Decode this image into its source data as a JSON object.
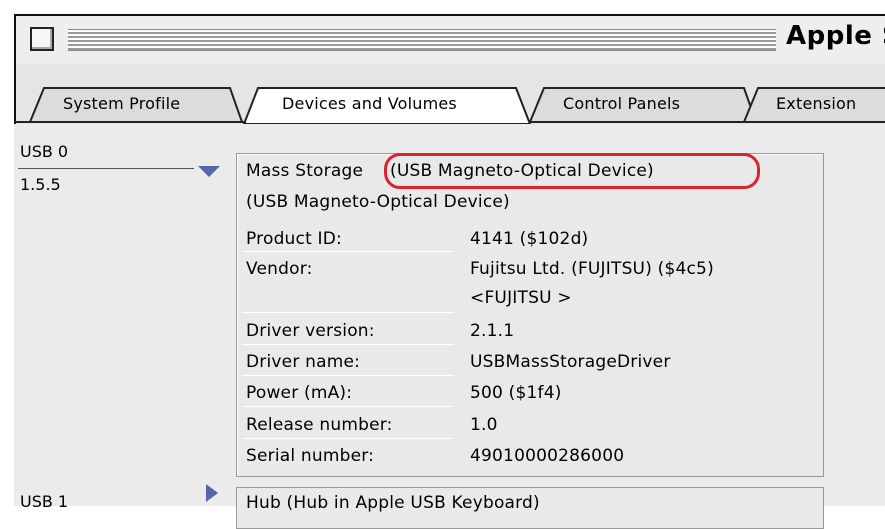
{
  "window": {
    "title": "Apple S"
  },
  "tabs": [
    {
      "label": "System Profile"
    },
    {
      "label": "Devices and Volumes"
    },
    {
      "label": "Control Panels"
    },
    {
      "label": "Extension"
    }
  ],
  "left_list": {
    "bus_label": "USB 0",
    "version": "1.5.5",
    "next_bus_label": "USB 1"
  },
  "device": {
    "title_prefix": "Mass Storage",
    "title_highlight": "(USB Magneto-Optical Device)",
    "subtitle": "(USB Magneto-Optical Device)",
    "properties": [
      {
        "label": "Product ID:",
        "value": "4141 ($102d)"
      },
      {
        "label": "Vendor:",
        "value": "Fujitsu Ltd. (FUJITSU) ($4c5)"
      },
      {
        "label": "",
        "value": "<FUJITSU >"
      },
      {
        "label": "Driver version:",
        "value": "2.1.1"
      },
      {
        "label": "Driver name:",
        "value": "USBMassStorageDriver"
      },
      {
        "label": "Power (mA):",
        "value": "500 ($1f4)"
      },
      {
        "label": "Release number:",
        "value": "1.0"
      },
      {
        "label": "Serial number:",
        "value": "49010000286000"
      }
    ]
  },
  "next_device": {
    "title": "Hub (Hub in Apple USB Keyboard)"
  },
  "colors": {
    "highlight": "#d9232d",
    "disclosure": "#5566aa"
  }
}
